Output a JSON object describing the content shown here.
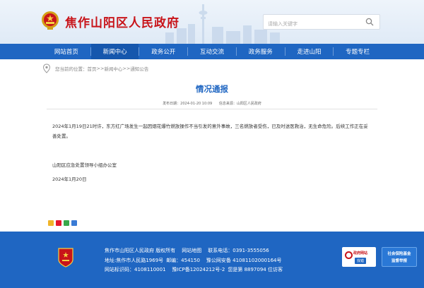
{
  "header": {
    "site_title": "焦作山阳区人民政府",
    "search_placeholder": "请输入关键字"
  },
  "nav": {
    "items": [
      {
        "label": "网站首页"
      },
      {
        "label": "新闻中心"
      },
      {
        "label": "政务公开"
      },
      {
        "label": "互动交流"
      },
      {
        "label": "政务服务"
      },
      {
        "label": "走进山阳"
      },
      {
        "label": "专题专栏"
      }
    ],
    "active_index": 1
  },
  "breadcrumb": {
    "prefix": "您当前的位置：",
    "home": "首页",
    "sep": ">>",
    "news": "新闻中心",
    "notice": "通知公告"
  },
  "article": {
    "title": "情况通报",
    "publish_label": "发布日期：",
    "publish_date": "2024-01-20 10:09",
    "source_label": "信息来源：",
    "source": "山阳区人民政府",
    "body": "2024年1月19日21时许，东方红广场发生一起因烟花爆竹燃放操作不当引发的意外事故，三名燃放者受伤，已及时送医救治，无生命危险。后续工作正在妥善处置。",
    "signer": "山阳区应急处置领导小组办公室",
    "date": "2024年1月20日"
  },
  "footer": {
    "owner": "焦作市山阳区人民政府 版权所有",
    "sitemap": "网站地图",
    "phone": "联系电话：0391-3555056",
    "address": "地址:焦作市人民路1969号",
    "postcode": "邮编：454150",
    "police": "豫公网安备 41081102000164号",
    "site_id": "网站标识码：4108110001",
    "icp": "豫ICP备12024212号-2",
    "visits": "您是第 8897094 位访客",
    "badge1_top": "政府网站",
    "badge1_bottom": "找错",
    "badge2_line1": "社会保险基金",
    "badge2_line2": "监督举报"
  },
  "colors": {
    "brand_red": "#c8141a",
    "nav_blue": "#1f66c2",
    "title_blue": "#1f66c2"
  },
  "icons": [
    "national-emblem-icon",
    "search-icon",
    "location-icon",
    "share-icons"
  ]
}
